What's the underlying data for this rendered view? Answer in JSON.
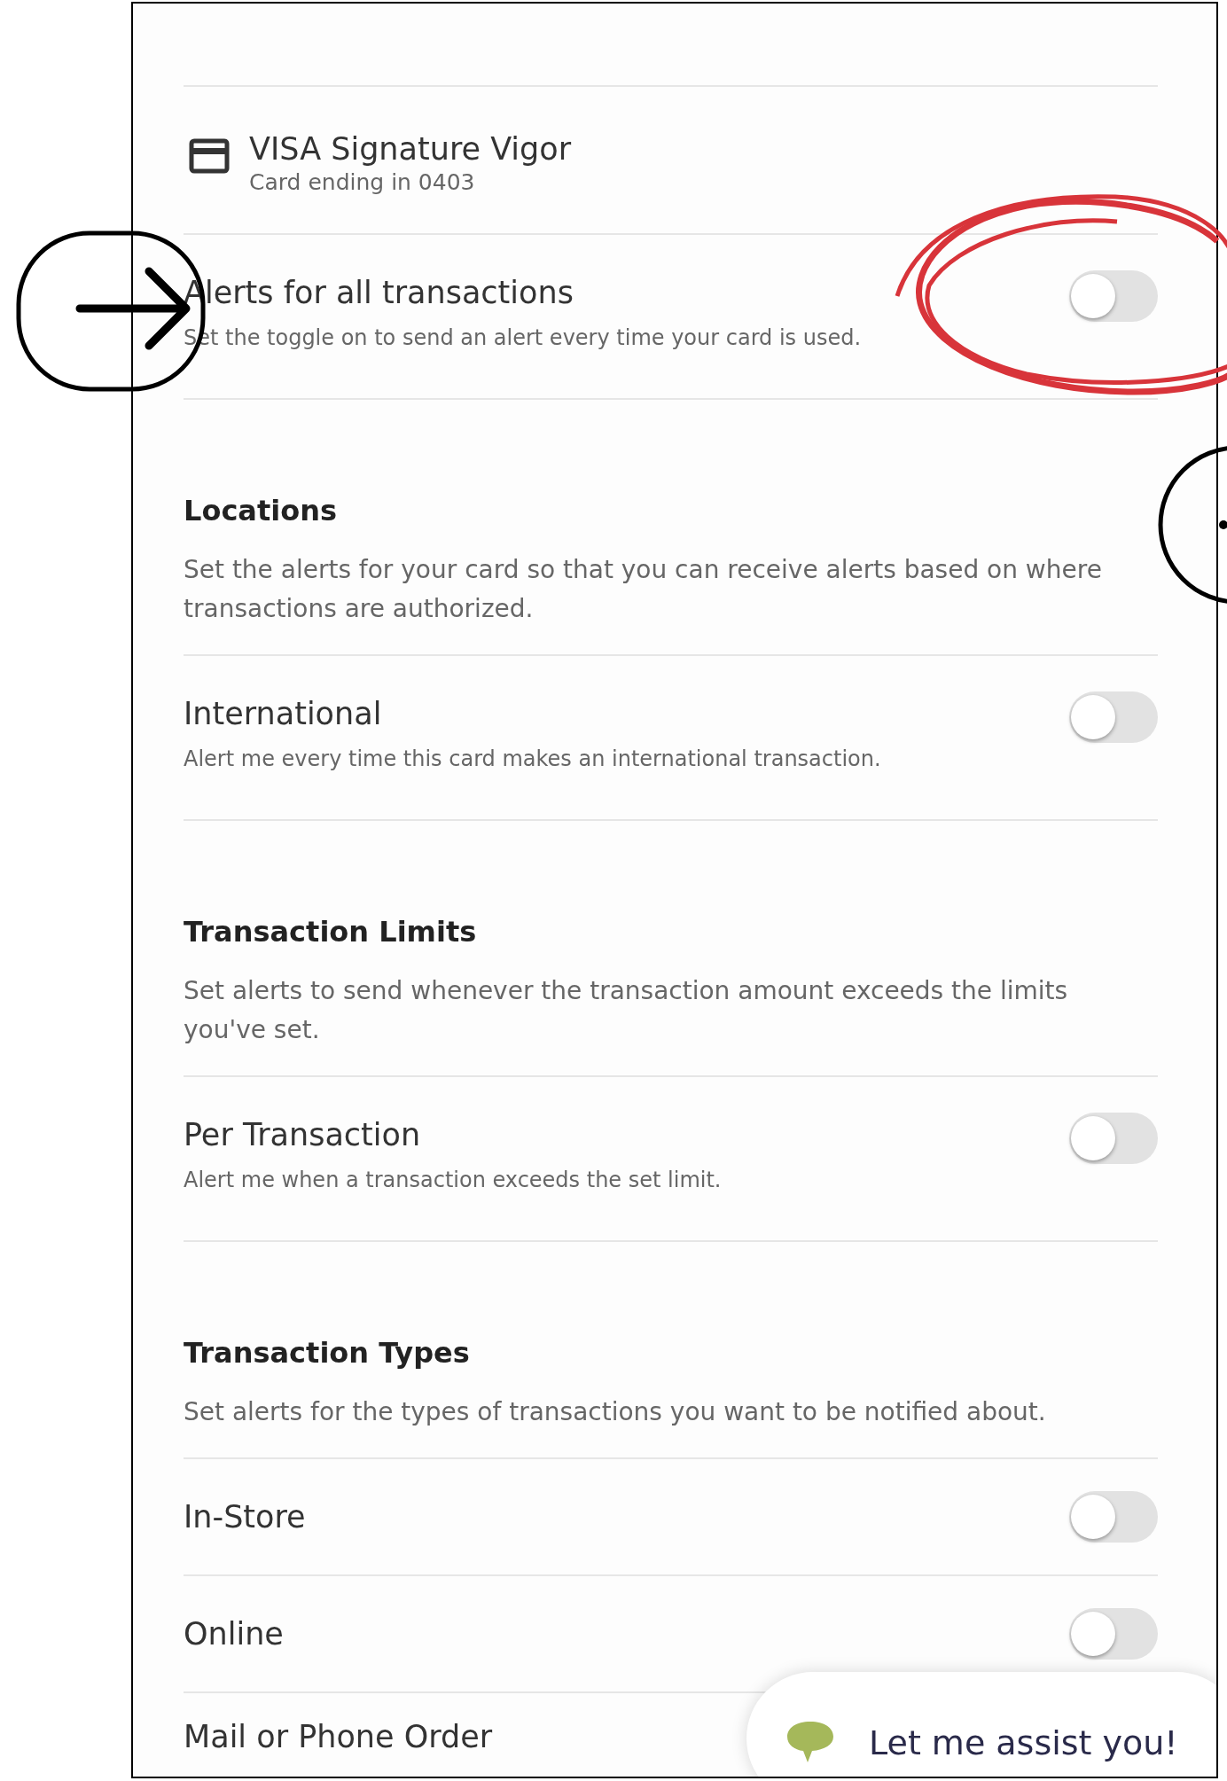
{
  "card": {
    "title": "VISA Signature Vigor",
    "subtitle": "Card ending in 0403"
  },
  "items": [
    {
      "kind": "toggle",
      "title": "Alerts for all transactions",
      "description": "Set the toggle on to send an alert every time your card is used.",
      "on": false
    },
    {
      "kind": "section",
      "title": "Locations",
      "description": "Set the alerts for your card so that you can receive alerts based on where transactions are authorized."
    },
    {
      "kind": "toggle",
      "title": "International",
      "description": "Alert me every time this card makes an international transaction.",
      "on": false
    },
    {
      "kind": "section",
      "title": "Transaction Limits",
      "description": "Set alerts to send whenever the transaction amount exceeds the limits you've set."
    },
    {
      "kind": "toggle",
      "title": "Per Transaction",
      "description": "Alert me when a transaction exceeds the set limit.",
      "on": false
    },
    {
      "kind": "section",
      "title": "Transaction Types",
      "description": "Set alerts for the types of transactions you want to be notified about."
    },
    {
      "kind": "toggle",
      "title": "In-Store",
      "on": false
    },
    {
      "kind": "toggle",
      "title": "Online",
      "on": false
    },
    {
      "kind": "toggle",
      "title": "Mail or Phone Order"
    }
  ],
  "chat": {
    "label": "Let me assist you!"
  }
}
